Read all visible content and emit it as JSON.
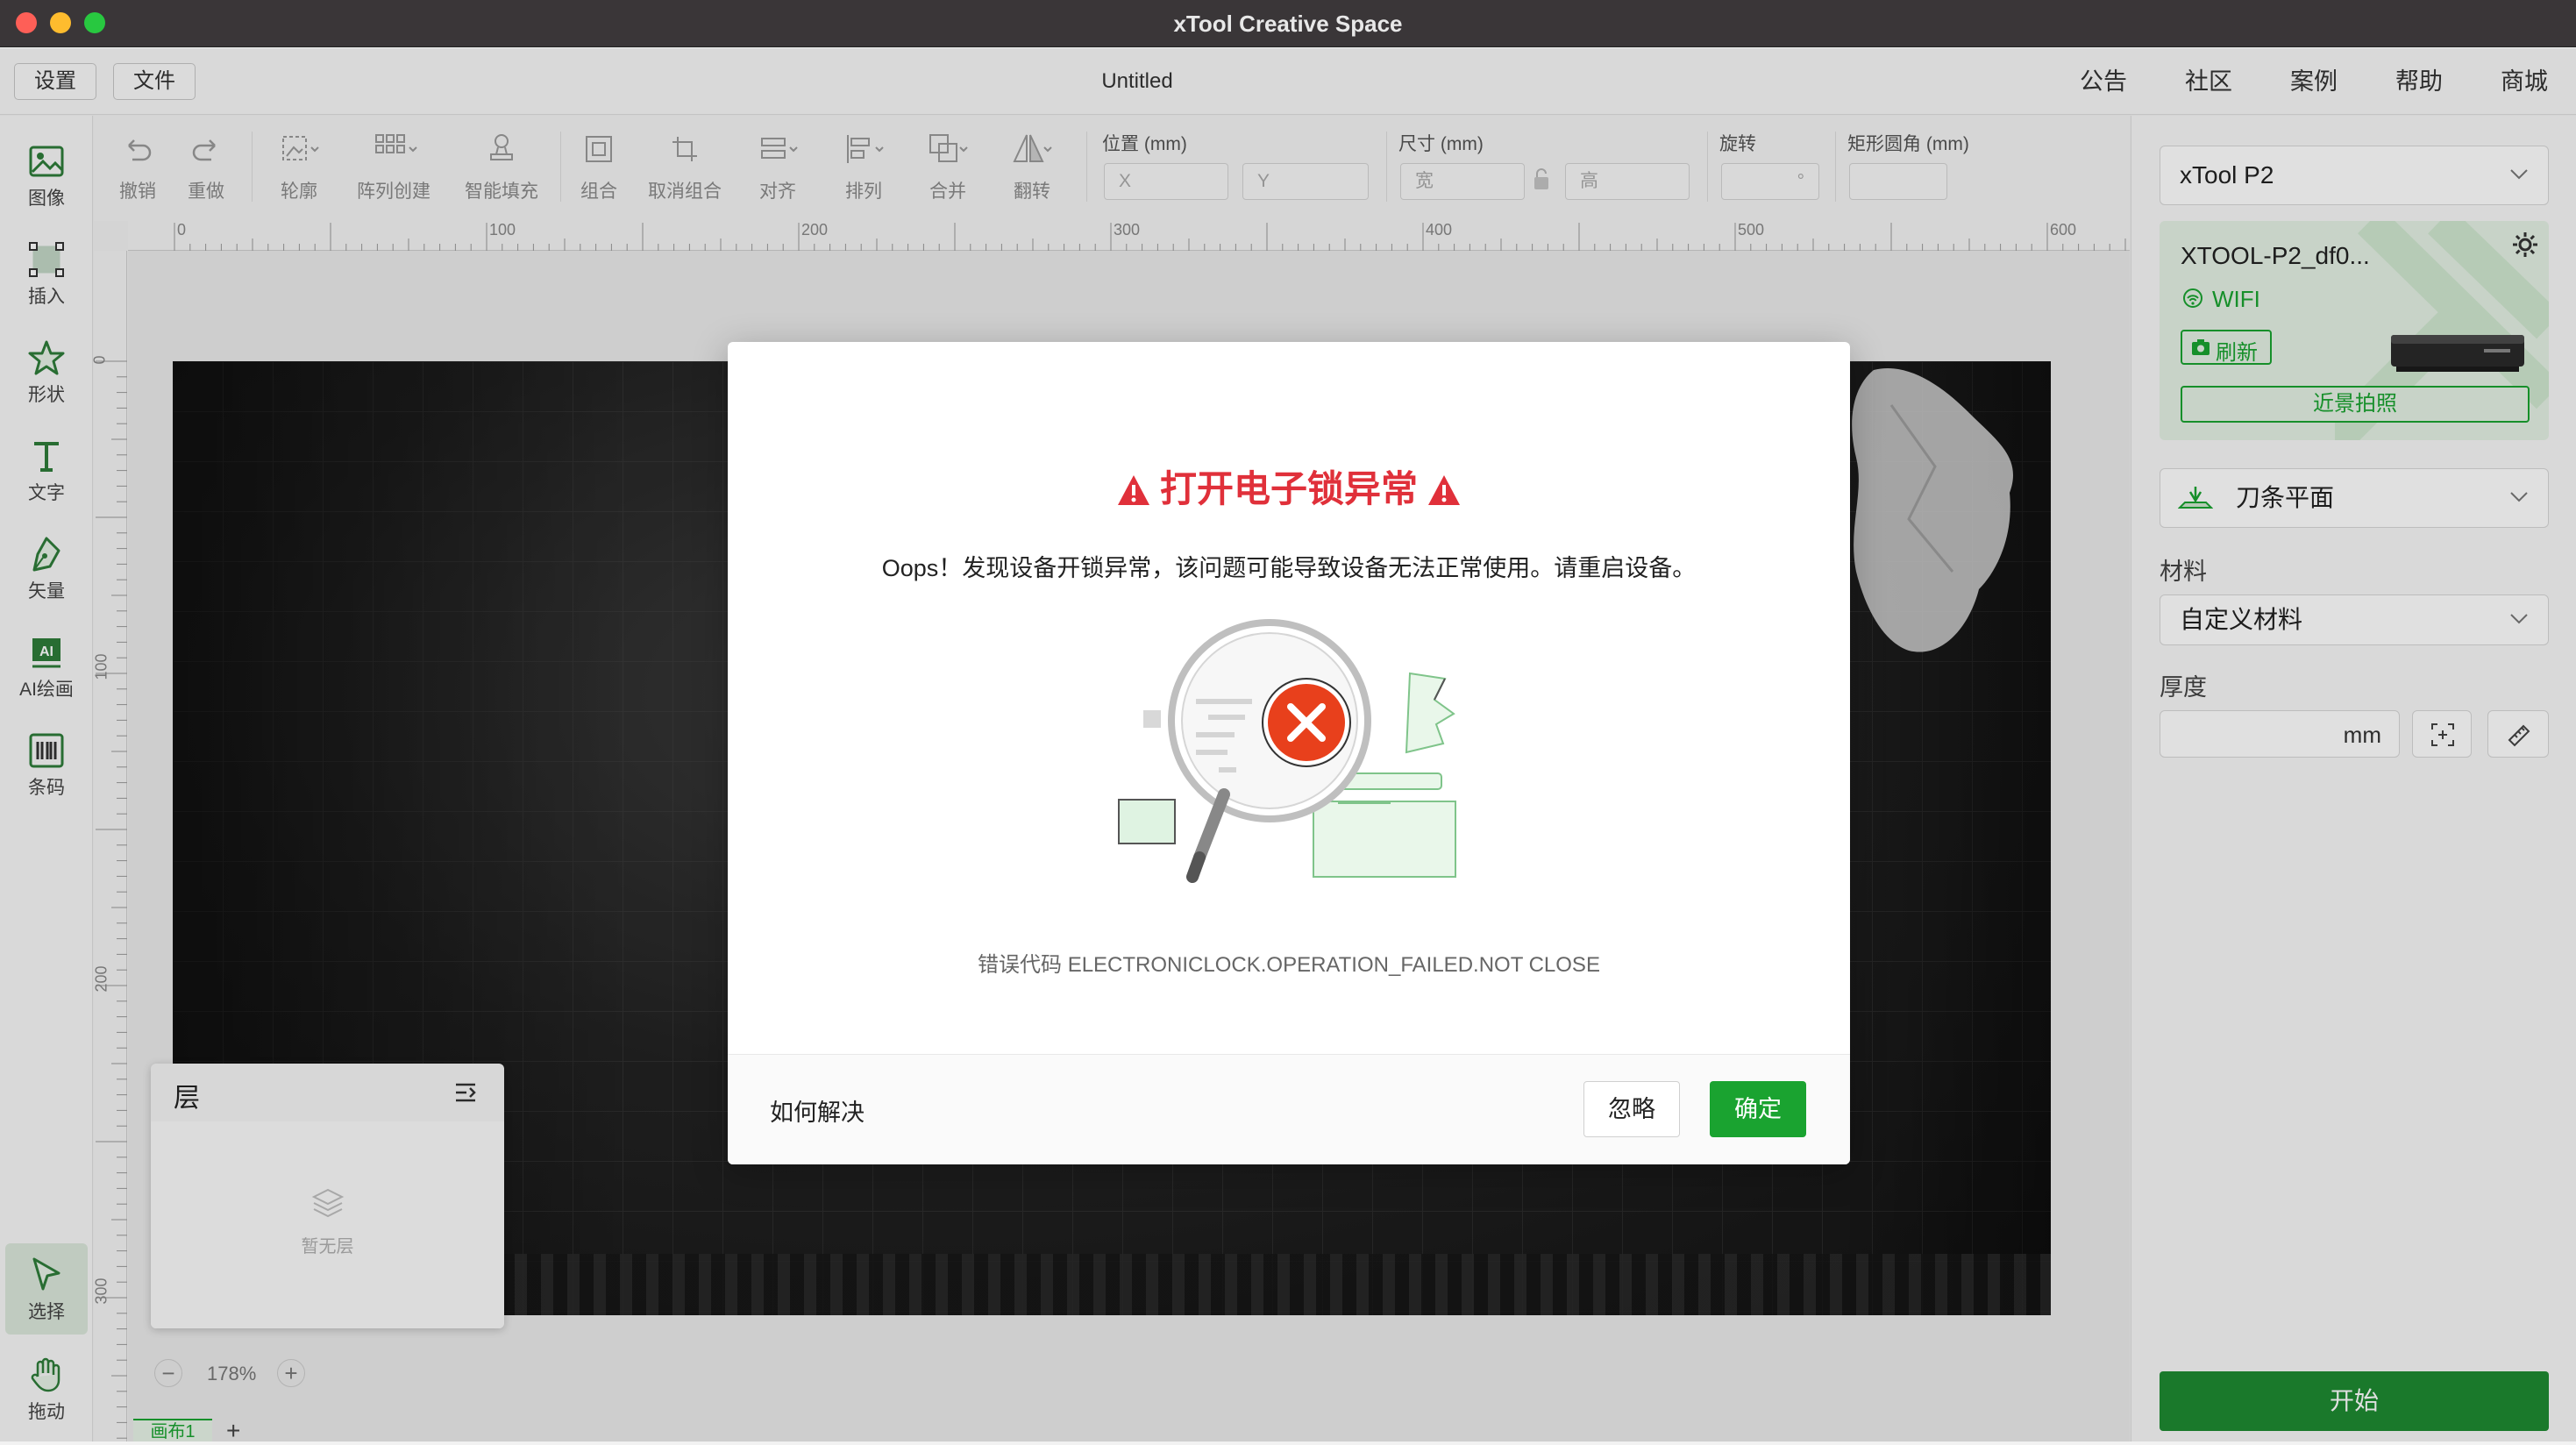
{
  "app": {
    "title": "xTool Creative Space"
  },
  "menu": {
    "settings": "设置",
    "file": "文件",
    "doc_title": "Untitled"
  },
  "top_links": [
    "公告",
    "社区",
    "案例",
    "帮助",
    "商城"
  ],
  "left_tools": [
    {
      "label": "图像",
      "icon": "image-icon"
    },
    {
      "label": "插入",
      "icon": "insert-icon"
    },
    {
      "label": "形状",
      "icon": "shape-icon"
    },
    {
      "label": "文字",
      "icon": "text-icon"
    },
    {
      "label": "矢量",
      "icon": "pen-icon"
    },
    {
      "label": "AI绘画",
      "icon": "ai-icon"
    },
    {
      "label": "条码",
      "icon": "barcode-icon"
    }
  ],
  "bottom_tools": [
    {
      "label": "选择",
      "icon": "cursor-icon"
    },
    {
      "label": "拖动",
      "icon": "hand-icon"
    }
  ],
  "toolbar": {
    "undo": "撤销",
    "redo": "重做",
    "outline": "轮廓",
    "array": "阵列创建",
    "smart_fill": "智能填充",
    "group": "组合",
    "ungroup": "取消组合",
    "align": "对齐",
    "arrange": "排列",
    "combine": "合并",
    "flip": "翻转",
    "position_label": "位置 (mm)",
    "x_placeholder": "X",
    "y_placeholder": "Y",
    "size_label": "尺寸 (mm)",
    "width_placeholder": "宽",
    "height_placeholder": "高",
    "rotate_label": "旋转",
    "rotate_unit": "°",
    "corner_label": "矩形圆角 (mm)"
  },
  "ruler": {
    "h_ticks": [
      "0",
      "100",
      "200",
      "300",
      "400",
      "500",
      "600"
    ],
    "v_ticks": [
      "0",
      "100",
      "200",
      "300"
    ]
  },
  "right": {
    "device": "xTool P2",
    "device_name": "XTOOL-P2_df0...",
    "connection": "WIFI",
    "refresh": "刷新",
    "capture": "近景拍照",
    "platform": "刀条平面",
    "material_label": "材料",
    "material": "自定义材料",
    "thickness_label": "厚度",
    "thickness_unit": "mm",
    "start": "开始"
  },
  "modal": {
    "title": "打开电子锁异常",
    "message": "Oops！发现设备开锁异常，该问题可能导致设备无法正常使用。请重启设备。",
    "error_code": "错误代码 ELECTRONICLOCK.OPERATION_FAILED.NOT CLOSE",
    "help": "如何解决",
    "ignore": "忽略",
    "confirm": "确定"
  },
  "layers": {
    "title": "层",
    "empty": "暂无层"
  },
  "zoom": {
    "value": "178%",
    "minus": "−",
    "plus": "+"
  },
  "canvas_tab": {
    "label": "画布1",
    "add": "+"
  },
  "colors": {
    "accent": "#1aa330",
    "error": "#e0303a",
    "start_button": "#1e8a32"
  }
}
